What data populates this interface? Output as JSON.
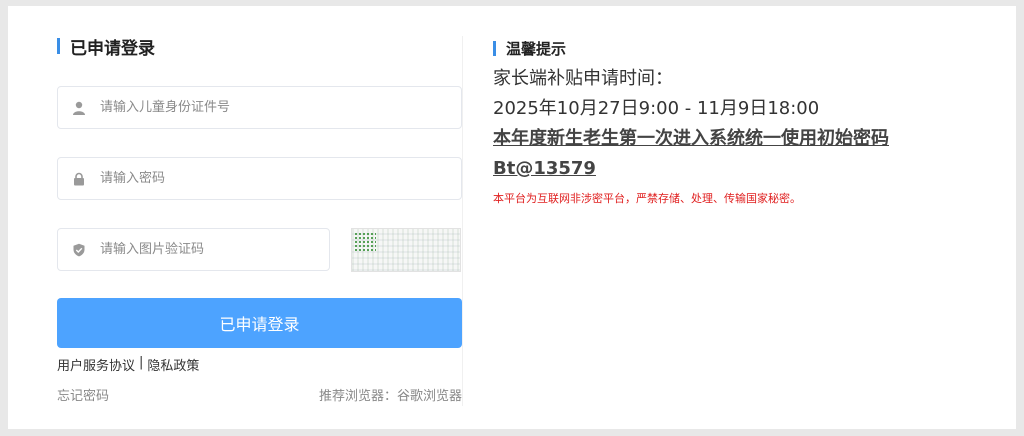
{
  "login": {
    "title": "已申请登录",
    "id_placeholder": "请输入儿童身份证件号",
    "password_placeholder": "请输入密码",
    "captcha_placeholder": "请输入图片验证码",
    "login_button": "已申请登录",
    "user_agreement": "用户服务协议",
    "separator": "|",
    "privacy_policy": "隐私政策",
    "forgot_password": "忘记密码",
    "browser_tip": "推荐浏览器：谷歌浏览器"
  },
  "notice": {
    "title": "温馨提示",
    "line1": "家长端补贴申请时间：",
    "line2": "2025年10月27日9:00 - 11月9日18:00",
    "line3": "本年度新生老生第一次进入系统统一使用初始密码",
    "line4": "Bt@13579",
    "warning": "本平台为互联网非涉密平台，严禁存储、处理、传输国家秘密。"
  },
  "colors": {
    "accent": "#3a8ee6",
    "button": "#4da3ff",
    "warning": "#e02020"
  },
  "icons": {
    "id_field": "user-icon",
    "password_field": "lock-icon",
    "captcha_field": "shield-check-icon"
  }
}
